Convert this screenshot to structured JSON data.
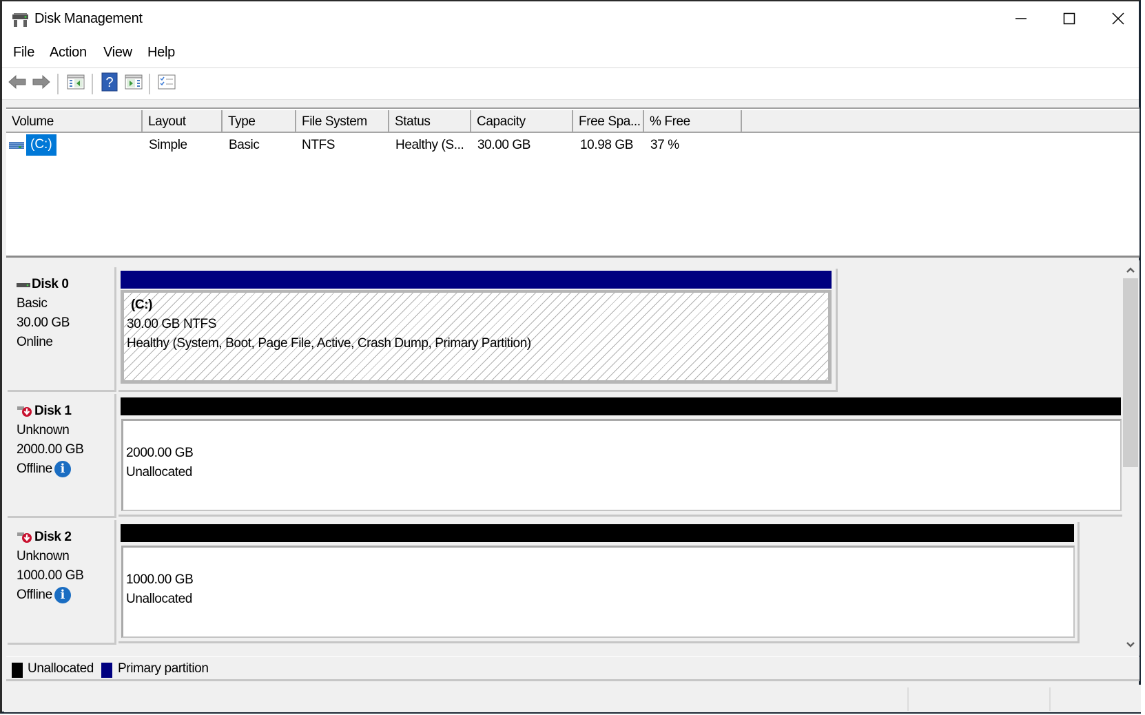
{
  "window": {
    "title": "Disk Management",
    "controls": {
      "minimize": "minimize",
      "maximize": "maximize",
      "close": "close"
    }
  },
  "menu": [
    "File",
    "Action",
    "View",
    "Help"
  ],
  "toolbar": {
    "buttons": [
      "back-icon",
      "forward-icon",
      "show-hide-console-tree-icon",
      "help-icon",
      "show-hide-action-pane-icon",
      "properties-icon"
    ]
  },
  "volume_list": {
    "columns": [
      "Volume",
      "Layout",
      "Type",
      "File System",
      "Status",
      "Capacity",
      "Free Spa...",
      "% Free"
    ],
    "rows": [
      {
        "volume": "(C:)",
        "layout": "Simple",
        "type": "Basic",
        "file_system": "NTFS",
        "status": "Healthy (S...",
        "capacity": "30.00 GB",
        "free_space": "10.98 GB",
        "percent_free": "37 %",
        "selected": true
      }
    ]
  },
  "disks": [
    {
      "name": "Disk 0",
      "type": "Basic",
      "size": "30.00 GB",
      "state": "Online",
      "icon": "disk-online-icon",
      "bar_color": "#000080",
      "partition": {
        "label": "(C:)",
        "size_fs": "30.00 GB NTFS",
        "status": "Healthy (System, Boot, Page File, Active, Crash Dump, Primary Partition)"
      }
    },
    {
      "name": "Disk 1",
      "type": "Unknown",
      "size": "2000.00 GB",
      "state": "Offline",
      "icon": "disk-offline-icon",
      "bar_color": "#000000",
      "partition": {
        "size": "2000.00 GB",
        "status": "Unallocated"
      }
    },
    {
      "name": "Disk 2",
      "type": "Unknown",
      "size": "1000.00 GB",
      "state": "Offline",
      "icon": "disk-offline-icon",
      "bar_color": "#000000",
      "partition": {
        "size": "1000.00 GB",
        "status": "Unallocated"
      }
    }
  ],
  "legend": [
    {
      "label": "Unallocated",
      "color": "#000000"
    },
    {
      "label": "Primary partition",
      "color": "#000080"
    }
  ],
  "colors": {
    "selection": "#0078d7",
    "primary_partition": "#000080",
    "unallocated": "#000000",
    "info": "#1a6dc2"
  }
}
